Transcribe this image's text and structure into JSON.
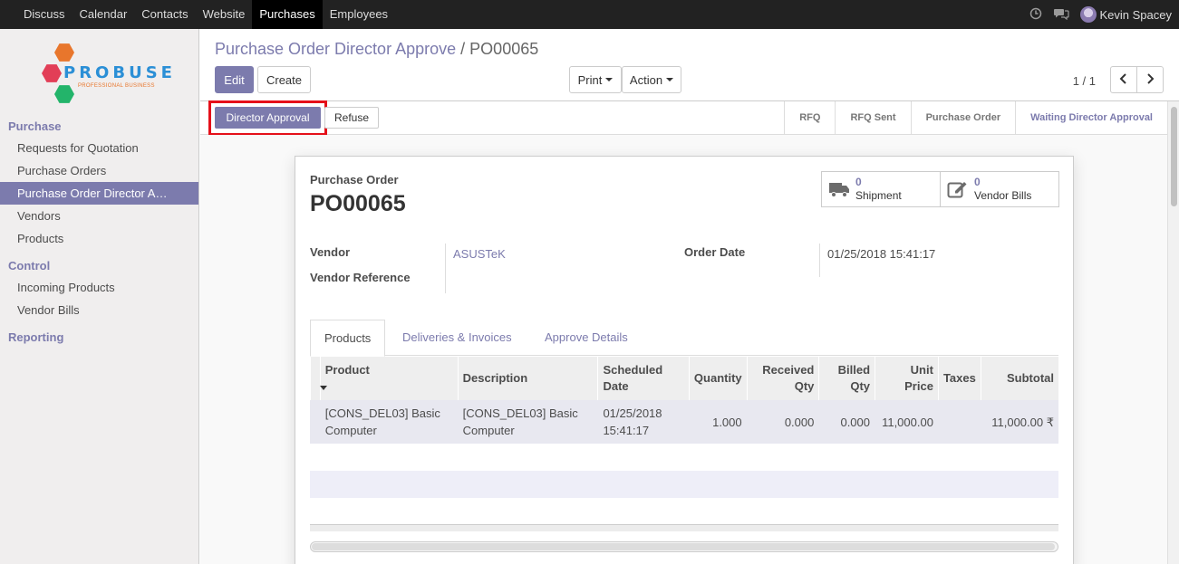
{
  "topbar": {
    "menu": [
      "Discuss",
      "Calendar",
      "Contacts",
      "Website",
      "Purchases",
      "Employees"
    ],
    "active_index": 4,
    "user": "Kevin Spacey"
  },
  "logo": {
    "word": "PROBUSE",
    "sub": "PROFESSIONAL BUSINESS"
  },
  "sidebar": {
    "sections": [
      {
        "title": "Purchase",
        "items": [
          "Requests for Quotation",
          "Purchase Orders",
          "Purchase Order Director A…",
          "Vendors",
          "Products"
        ]
      },
      {
        "title": "Control",
        "items": [
          "Incoming Products",
          "Vendor Bills"
        ]
      },
      {
        "title": "Reporting",
        "items": []
      }
    ],
    "active_item": "Purchase Order Director A…"
  },
  "breadcrumb": {
    "parent": "Purchase Order Director Approve",
    "separator": "/",
    "current": "PO00065"
  },
  "buttons": {
    "edit": "Edit",
    "create": "Create",
    "print": "Print",
    "action": "Action"
  },
  "pager": {
    "text": "1 / 1"
  },
  "statusbar": {
    "director_approval": "Director Approval",
    "refuse": "Refuse",
    "stages": [
      "RFQ",
      "RFQ Sent",
      "Purchase Order",
      "Waiting Director Approval"
    ],
    "current_stage": "Waiting Director Approval"
  },
  "sheet": {
    "subtitle": "Purchase Order",
    "title": "PO00065",
    "smart_buttons": [
      {
        "value": "0",
        "label": "Shipment",
        "icon": "truck-icon"
      },
      {
        "value": "0",
        "label": "Vendor Bills",
        "icon": "pencil-square-icon"
      }
    ],
    "fields": {
      "vendor_label": "Vendor",
      "vendor_value": "ASUSTeK",
      "vendor_ref_label": "Vendor Reference",
      "order_date_label": "Order Date",
      "order_date_value": "01/25/2018 15:41:17"
    },
    "tabs": [
      "Products",
      "Deliveries & Invoices",
      "Approve Details"
    ],
    "table": {
      "headers": [
        "Product",
        "Description",
        "Scheduled Date",
        "Quantity",
        "Received Qty",
        "Billed Qty",
        "Unit Price",
        "Taxes",
        "Subtotal"
      ],
      "rows": [
        [
          "[CONS_DEL03] Basic Computer",
          "[CONS_DEL03] Basic Computer",
          "01/25/2018 15:41:17",
          "1.000",
          "0.000",
          "0.000",
          "11,000.00",
          "",
          "11,000.00 ₹"
        ]
      ]
    }
  }
}
